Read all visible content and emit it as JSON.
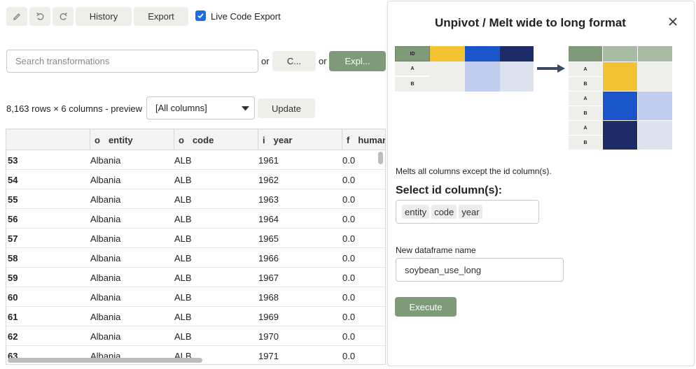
{
  "toolbar": {
    "history_label": "History",
    "export_label": "Export",
    "live_code_export_label": "Live Code Export",
    "live_code_export_checked": true
  },
  "search": {
    "placeholder": "Search transformations",
    "or_1": "or",
    "button_c_label": "C...",
    "or_2": "or",
    "explore_label": "Expl..."
  },
  "preview": {
    "summary": "8,163 rows × 6 columns - preview",
    "column_select_value": "[All columns]",
    "update_label": "Update"
  },
  "table": {
    "columns": [
      {
        "type": "",
        "name": ""
      },
      {
        "type": "o",
        "name": "entity"
      },
      {
        "type": "o",
        "name": "code"
      },
      {
        "type": "i",
        "name": "year"
      },
      {
        "type": "f",
        "name": "human"
      }
    ],
    "rows": [
      [
        "53",
        "Albania",
        "ALB",
        "1961",
        "0.0"
      ],
      [
        "54",
        "Albania",
        "ALB",
        "1962",
        "0.0"
      ],
      [
        "55",
        "Albania",
        "ALB",
        "1963",
        "0.0"
      ],
      [
        "56",
        "Albania",
        "ALB",
        "1964",
        "0.0"
      ],
      [
        "57",
        "Albania",
        "ALB",
        "1965",
        "0.0"
      ],
      [
        "58",
        "Albania",
        "ALB",
        "1966",
        "0.0"
      ],
      [
        "59",
        "Albania",
        "ALB",
        "1967",
        "0.0"
      ],
      [
        "60",
        "Albania",
        "ALB",
        "1968",
        "0.0"
      ],
      [
        "61",
        "Albania",
        "ALB",
        "1969",
        "0.0"
      ],
      [
        "62",
        "Albania",
        "ALB",
        "1970",
        "0.0"
      ],
      [
        "63",
        "Albania",
        "ALB",
        "1971",
        "0.0"
      ]
    ]
  },
  "panel": {
    "title": "Unpivot / Melt wide to long format",
    "diagram": {
      "id_label": "ID",
      "row_a": "A",
      "row_b": "B"
    },
    "description": "Melts all columns except the id column(s).",
    "id_section_label": "Select id column(s):",
    "id_columns": [
      "entity",
      "code",
      "year"
    ],
    "name_label": "New dataframe name",
    "name_value": "soybean_use_long",
    "execute_label": "Execute"
  },
  "colors": {
    "accent_green": "#7e9a79",
    "yellow": "#f2c232",
    "blue": "#1a56c9",
    "navy": "#1d2c66"
  }
}
